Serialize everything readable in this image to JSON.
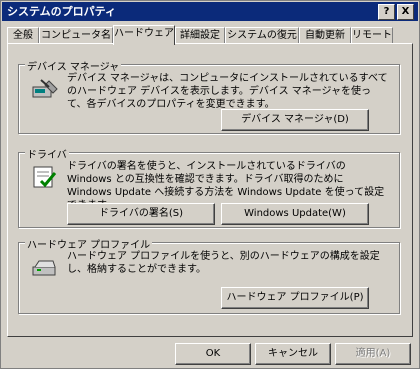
{
  "window": {
    "title": "システムのプロパティ",
    "help_button": "?",
    "close_button": "X"
  },
  "tabs": [
    "全般",
    "コンピュータ名",
    "ハードウェア",
    "詳細設定",
    "システムの復元",
    "自動更新",
    "リモート"
  ],
  "active_tab": "ハードウェア",
  "device_manager": {
    "title": "デバイス マネージャ",
    "description": "デバイス マネージャは、コンピュータにインストールされているすべてのハードウェア デバイスを表示します。デバイス マネージャを使って、各デバイスのプロパティを変更できます。",
    "button": "デバイス マネージャ(D)"
  },
  "drivers": {
    "title": "ドライバ",
    "description": "ドライバの署名を使うと、インストールされているドライバの Windows との互換性を確認できます。ドライバ取得のために Windows Update へ接続する方法を Windows Update を使って設定できます。",
    "signing_button": "ドライバの署名(S)",
    "update_button": "Windows Update(W)"
  },
  "hardware_profiles": {
    "title": "ハードウェア プロファイル",
    "description": "ハードウェア プロファイルを使うと、別のハードウェアの構成を設定し、格納することができます。",
    "button": "ハードウェア プロファイル(P)"
  },
  "footer": {
    "ok": "OK",
    "cancel": "キャンセル",
    "apply": "適用(A)"
  }
}
